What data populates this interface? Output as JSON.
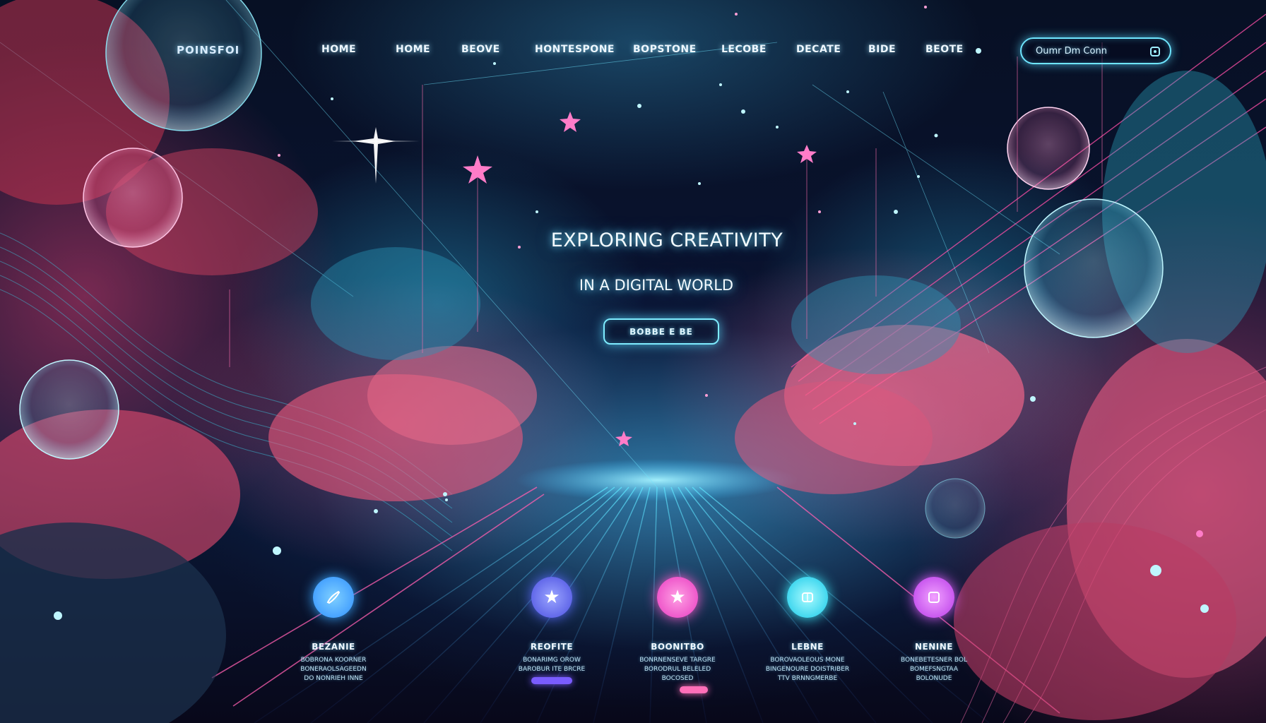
{
  "logo": {
    "text": "POINSFOI"
  },
  "nav": {
    "items": [
      {
        "label": "HOME"
      },
      {
        "label": "HOME"
      },
      {
        "label": "BEOVE"
      },
      {
        "label": "HONTESPONE"
      },
      {
        "label": "BOPSTONE"
      },
      {
        "label": "LECOBE"
      },
      {
        "label": "DECATE"
      },
      {
        "label": "BIDE"
      },
      {
        "label": "BEOTE"
      }
    ]
  },
  "search": {
    "text": "Oumr Dm Conn",
    "icon": "square-search-icon"
  },
  "hero": {
    "title": "EXPLORING CREATIVITY",
    "subtitle": "IN A DIGITAL WORLD",
    "cta": "BOBBE E BE"
  },
  "features": [
    {
      "title": "BEZANIE",
      "icon": "brush-icon",
      "color": "#3aa8ff",
      "desc": [
        "BOBRONA KOORNER",
        "BONERAOLSAGEEDN",
        "DO NONRIEH INNE"
      ]
    },
    {
      "title": "REOFITE",
      "icon": "star-icon",
      "color": "#5b6cff",
      "desc": [
        "BONARIMG OROW",
        "BAROBUR ITE BRCRE",
        ""
      ],
      "pill": "#7a5cff"
    },
    {
      "title": "BOONITBO",
      "icon": "sparkle-icon",
      "color": "#ff5fd0",
      "desc": [
        "BONRNENSEVE TARGRE",
        "BORODRUL BELELED",
        "BOCOSED"
      ],
      "pill": "#ff6fb8"
    },
    {
      "title": "LEBNE",
      "icon": "cube-icon",
      "color": "#3ff0ff",
      "desc": [
        "BOROVAOLEOUS MONE",
        "BINGENOURE DOISTRIBER",
        "TTV BRNNGMERBE"
      ]
    },
    {
      "title": "NENINE",
      "icon": "square-icon",
      "color": "#e05fff",
      "desc": [
        "BONEBETESNER BOL",
        "BOMEFSNGTAA",
        "BOLONUDE"
      ]
    }
  ]
}
